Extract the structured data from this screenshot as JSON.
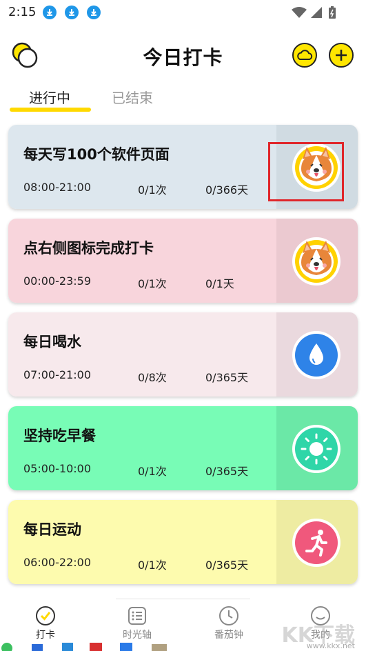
{
  "status_bar": {
    "time": "2:15"
  },
  "header": {
    "title": "今日打卡"
  },
  "tabs": [
    {
      "label": "进行中",
      "active": true
    },
    {
      "label": "已结束",
      "active": false
    }
  ],
  "cards": [
    {
      "title": "每天写100个软件页面",
      "time": "08:00-21:00",
      "count": "0/1次",
      "days": "0/366天",
      "icon": "corgi-icon",
      "bg": "#dde7ee",
      "side_bg": "#d0dbe2"
    },
    {
      "title": "点右侧图标完成打卡",
      "time": "00:00-23:59",
      "count": "0/1次",
      "days": "0/1天",
      "icon": "corgi-icon",
      "bg": "#f8d5dc",
      "side_bg": "#ebc9d0"
    },
    {
      "title": "每日喝水",
      "time": "07:00-21:00",
      "count": "0/8次",
      "days": "0/365天",
      "icon": "water-drop-icon",
      "bg": "#f7e9ec",
      "side_bg": "#ead9de"
    },
    {
      "title": "坚持吃早餐",
      "time": "05:00-10:00",
      "count": "0/1次",
      "days": "0/365天",
      "icon": "sun-icon",
      "bg": "#78fcb6",
      "side_bg": "#6be8a7"
    },
    {
      "title": "每日运动",
      "time": "06:00-22:00",
      "count": "0/1次",
      "days": "0/365天",
      "icon": "running-icon",
      "bg": "#fdfbae",
      "side_bg": "#eeeca2"
    }
  ],
  "bottom_nav": [
    {
      "label": "打卡",
      "icon": "checkin-icon",
      "active": true
    },
    {
      "label": "时光轴",
      "icon": "timeline-icon",
      "active": false
    },
    {
      "label": "番茄钟",
      "icon": "clock-icon",
      "active": false
    },
    {
      "label": "我的",
      "icon": "profile-icon",
      "active": false
    }
  ],
  "watermark": {
    "text": "KK下载",
    "url": "www.kkx.net"
  },
  "colors": {
    "accent": "#ffd900",
    "highlight": "#e0262a"
  }
}
